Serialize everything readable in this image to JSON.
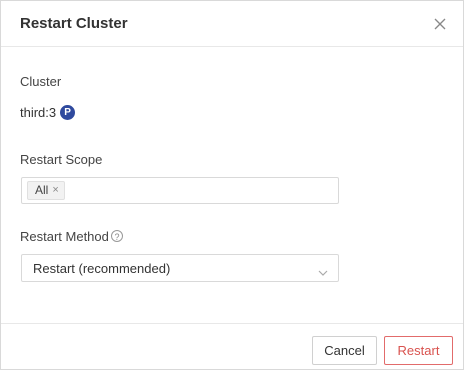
{
  "dialog": {
    "title": "Restart Cluster",
    "close_icon": "close-icon"
  },
  "cluster": {
    "label": "Cluster",
    "value": "third:3",
    "badge": "P"
  },
  "scope": {
    "label": "Restart Scope",
    "tags": [
      "All"
    ],
    "remove_symbol": "×"
  },
  "method": {
    "label": "Restart Method",
    "help_icon": "question-circle-icon",
    "help_symbol": "?",
    "selected": "Restart (recommended)"
  },
  "footer": {
    "cancel_label": "Cancel",
    "restart_label": "Restart"
  },
  "colors": {
    "badge_bg": "#2f4a9e",
    "danger": "#d9534f"
  }
}
